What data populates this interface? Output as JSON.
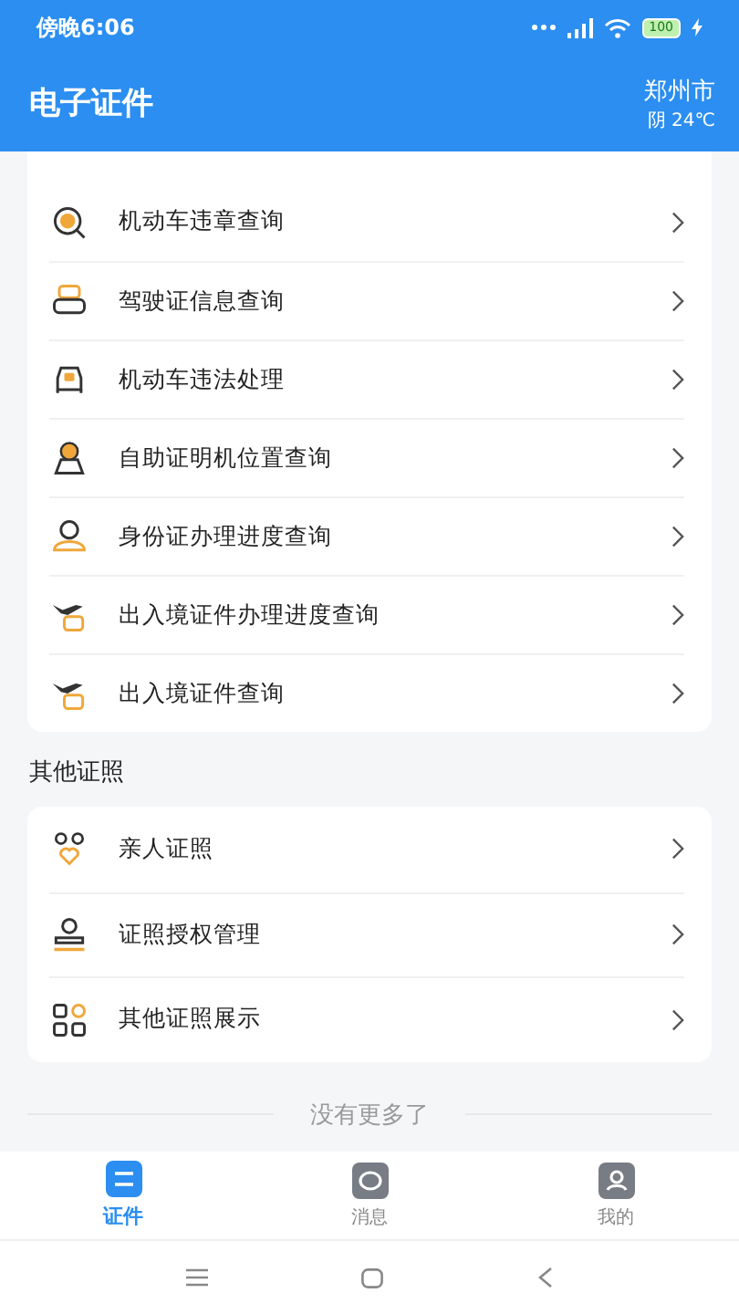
{
  "status_bar": {
    "time": "傍晚6:06",
    "battery": "100"
  },
  "header": {
    "title": "电子证件",
    "city": "郑州市",
    "weather": "阴 24℃"
  },
  "services": [
    {
      "label": "机动车违章查询"
    },
    {
      "label": "驾驶证信息查询"
    },
    {
      "label": "机动车违法处理"
    },
    {
      "label": "自助证明机位置查询"
    },
    {
      "label": "身份证办理进度查询"
    },
    {
      "label": "出入境证件办理进度查询"
    },
    {
      "label": "出入境证件查询"
    }
  ],
  "other_section": {
    "title": "其他证照",
    "items": [
      {
        "label": "亲人证照"
      },
      {
        "label": "证照授权管理"
      },
      {
        "label": "其他证照展示"
      }
    ]
  },
  "end_note": "没有更多了",
  "tabs": [
    {
      "label": "证件",
      "selected": true
    },
    {
      "label": "消息",
      "selected": false
    },
    {
      "label": "我的",
      "selected": false
    }
  ]
}
